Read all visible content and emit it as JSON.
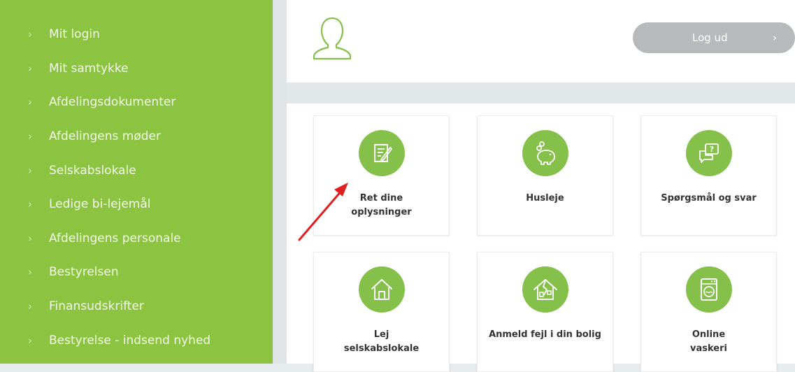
{
  "sidebar": {
    "items": [
      {
        "label": "Mit login"
      },
      {
        "label": "Mit samtykke"
      },
      {
        "label": "Afdelingsdokumenter"
      },
      {
        "label": "Afdelingens møder"
      },
      {
        "label": "Selskabslokale"
      },
      {
        "label": "Ledige bi-lejemål"
      },
      {
        "label": "Afdelingens personale"
      },
      {
        "label": "Bestyrelsen"
      },
      {
        "label": "Finansudskrifter"
      },
      {
        "label": "Bestyrelse - indsend nyhed"
      }
    ],
    "chevron": "›"
  },
  "header": {
    "logout_label": "Log ud",
    "logout_chevron": "›",
    "user_icon": "user-outline-icon"
  },
  "tiles": [
    {
      "title": "Ret dine\noplysninger",
      "icon": "edit-form-icon"
    },
    {
      "title": "Husleje",
      "icon": "piggy-bank-icon"
    },
    {
      "title": "Spørgsmål og svar",
      "icon": "chat-question-icon"
    },
    {
      "title": "Lej\nselskabslokale",
      "icon": "house-icon"
    },
    {
      "title": "Anmeld fejl i din bolig",
      "icon": "broken-house-icon"
    },
    {
      "title": "Online\nvaskeri",
      "icon": "washing-machine-icon"
    }
  ],
  "colors": {
    "sidebar_bg": "#8cc442",
    "accent": "#84c04a",
    "logout_bg": "#b7b9bb",
    "arrow": "#e02020"
  }
}
